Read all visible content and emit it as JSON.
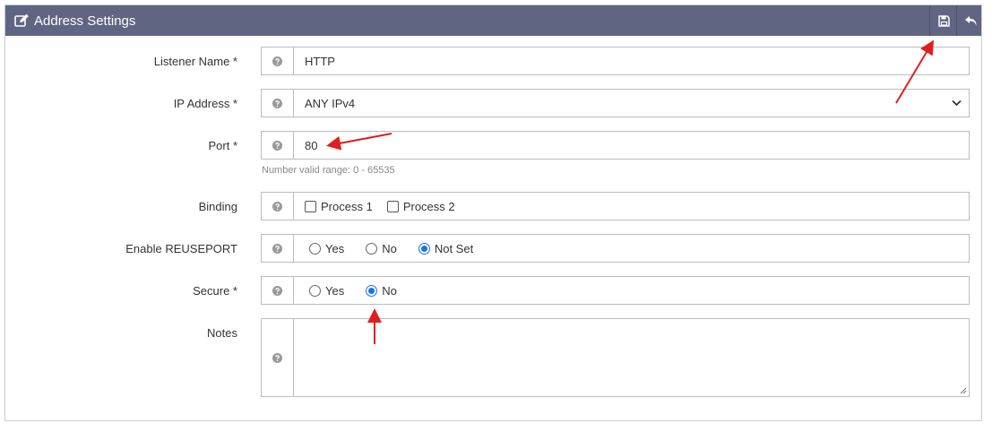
{
  "header": {
    "title": "Address Settings",
    "icons": {
      "edit": "edit-icon",
      "save": "floppy-disk-icon",
      "undo": "undo-arrow-icon"
    },
    "colors": {
      "background": "#606582",
      "text": "#ffffff"
    }
  },
  "form": {
    "listener_name": {
      "label": "Listener Name *",
      "value": "HTTP"
    },
    "ip_address": {
      "label": "IP Address *",
      "value": "ANY IPv4"
    },
    "port": {
      "label": "Port *",
      "value": "80",
      "hint": "Number valid range: 0 - 65535"
    },
    "binding": {
      "label": "Binding",
      "options": [
        {
          "label": "Process 1",
          "checked": false
        },
        {
          "label": "Process 2",
          "checked": false
        }
      ]
    },
    "reuseport": {
      "label": "Enable REUSEPORT",
      "options": [
        {
          "label": "Yes",
          "selected": false
        },
        {
          "label": "No",
          "selected": false
        },
        {
          "label": "Not Set",
          "selected": true
        }
      ]
    },
    "secure": {
      "label": "Secure *",
      "options": [
        {
          "label": "Yes",
          "selected": false
        },
        {
          "label": "No",
          "selected": true
        }
      ]
    },
    "notes": {
      "label": "Notes",
      "value": ""
    }
  },
  "colors": {
    "accent": "#1a73e8",
    "annotation_arrow": "#dd1f1f"
  }
}
